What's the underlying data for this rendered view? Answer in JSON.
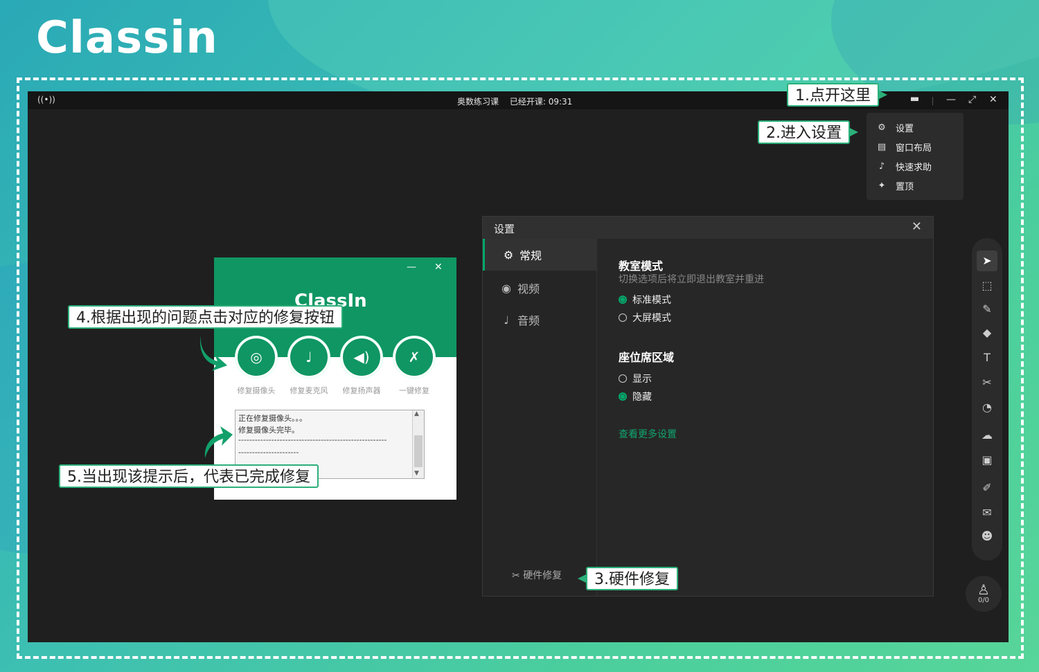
{
  "brand": {
    "logo_text": "Classin"
  },
  "titlebar": {
    "class_name": "奥数练习课",
    "elapsed": "已经开课: 09:31",
    "signal_icon": "broadcast-icon",
    "minimize": "—",
    "restore": "⤢",
    "close": "✕",
    "menu_icon": "▪▪"
  },
  "menu": {
    "items": [
      {
        "label": "设置",
        "icon": "gear-icon"
      },
      {
        "label": "窗口布局",
        "icon": "layout-icon"
      },
      {
        "label": "快速求助",
        "icon": "bell-icon"
      },
      {
        "label": "置顶",
        "icon": "pin-icon"
      }
    ]
  },
  "settings": {
    "title": "设置",
    "close": "✕",
    "tabs": [
      {
        "label": "常规",
        "active": true
      },
      {
        "label": "视频",
        "active": false
      },
      {
        "label": "音频",
        "active": false
      }
    ],
    "hardware_repair": "硬件修复",
    "classroom_mode": {
      "title": "教室模式",
      "subtitle": "切换选项后将立即退出教室并重进",
      "options": [
        {
          "label": "标准模式",
          "selected": true
        },
        {
          "label": "大屏模式",
          "selected": false
        }
      ]
    },
    "seat_area": {
      "title": "座位席区域",
      "options": [
        {
          "label": "显示",
          "selected": false
        },
        {
          "label": "隐藏",
          "selected": true
        }
      ]
    },
    "more_settings": "查看更多设置"
  },
  "toolbar": {
    "tools": [
      "cursor-icon",
      "select-icon",
      "pen-icon",
      "eraser-icon",
      "text-icon",
      "scissors-icon",
      "timer-icon",
      "cloud-icon",
      "toolbox-icon",
      "edit-icon",
      "chat-icon",
      "users-icon"
    ],
    "seat_count": "0/0"
  },
  "repair_window": {
    "brand": "ClassIn",
    "buttons": [
      {
        "label": "修复摄像头",
        "icon": "camera-icon"
      },
      {
        "label": "修复麦克风",
        "icon": "microphone-icon"
      },
      {
        "label": "修复扬声器",
        "icon": "speaker-icon"
      },
      {
        "label": "一键修复",
        "icon": "wrench-icon"
      }
    ],
    "log_lines": [
      "正在修复摄像头。。。",
      "修复摄像头完毕。",
      "------------------------------------------------------",
      "----------------------"
    ]
  },
  "callouts": {
    "c1": "1.点开这里",
    "c2": "2.进入设置",
    "c3": "3.硬件修复",
    "c4": "4.根据出现的问题点击对应的修复按钮",
    "c5": "5.当出现该提示后，代表已完成修复"
  },
  "colors": {
    "accent": "#0f9663",
    "callout_border": "#2bb07a",
    "app_bg": "#1f1f1f"
  }
}
